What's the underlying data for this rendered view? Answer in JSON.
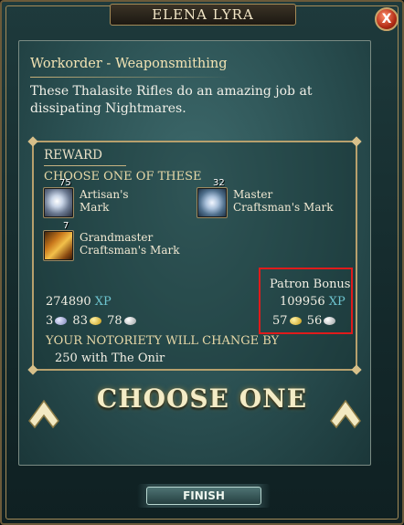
{
  "window": {
    "title": "ELENA LYRA",
    "close_label": "X"
  },
  "workorder": {
    "title": "Workorder - Weaponsmithing",
    "description": "These Thalasite Rifles do an amazing job at dissipating Nightmares."
  },
  "reward": {
    "label": "REWARD",
    "choose_label": "CHOOSE ONE OF THESE",
    "items": [
      {
        "name": "Artisan's Mark",
        "count": "75",
        "icon": "artisans-mark-icon"
      },
      {
        "name": "Master Craftsman's Mark",
        "count": "32",
        "icon": "master-craftsmans-mark-icon"
      },
      {
        "name": "Grandmaster Craftsman's Mark",
        "count": "7",
        "icon": "grandmaster-craftsmans-mark-icon"
      }
    ],
    "base": {
      "xp": "274890",
      "xp_label": "XP",
      "platinum": "3",
      "gold": "83",
      "silver": "78"
    },
    "patron": {
      "label": "Patron Bonus",
      "xp": "109956",
      "xp_label": "XP",
      "gold": "57",
      "silver": "56"
    },
    "notoriety_label": "YOUR NOTORIETY WILL CHANGE BY",
    "notoriety_value": "250 with The Onir"
  },
  "choose_one": "CHOOSE ONE",
  "finish_label": "FINISH",
  "colors": {
    "xp": "#6ec5d0",
    "highlight": "#e01b1b",
    "gold_text": "#f4ecc6"
  }
}
